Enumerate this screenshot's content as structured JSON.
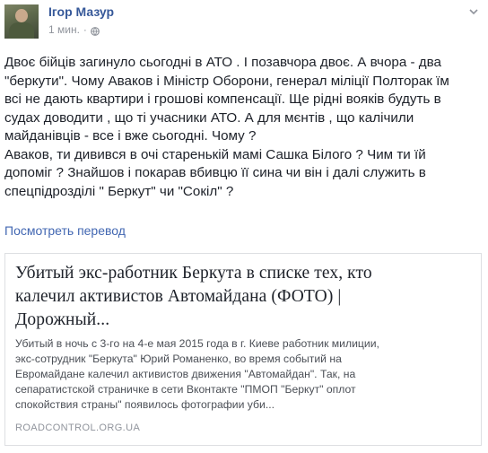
{
  "header": {
    "author_name": "Ігор Мазур",
    "timestamp": "1 мин.",
    "separator": "·",
    "privacy_icon": "globe-icon",
    "menu_icon": "chevron-down-icon"
  },
  "post": {
    "lines": [
      "Двоє бійців загинуло сьогодні в АТО . І позавчора двоє. А вчора - два",
      "\"беркути\". Чому Аваков і Міністр Оборони, генерал міліції Полторак їм",
      "всі не дають квартири і грошові компенсації. Ще рідні вояків будуть в",
      "судах доводити , що ті учасники АТО. А для мєнтів , що калічили",
      "майданівців - все і вже сьогодні. Чому ?",
      "Аваков, ти дивився в очі старенькій мамі Сашка Білого ? Чим ти їй",
      "допоміг ? Знайшов і покарав вбивцю її сина чи він і далі служить в",
      "спецпідрозділі \" Беркут\" чи \"Сокіл\" ?"
    ],
    "see_translation": "Посмотреть перевод"
  },
  "link_card": {
    "title_lines": [
      "Убитый экс-работник Беркута в списке тех, кто",
      "калечил активистов Автомайдана (ФОТО) |",
      "Дорожный..."
    ],
    "description_lines": [
      "Убитый в ночь с 3-го на 4-е мая 2015 года в г. Киеве работник милиции,",
      "экс-сотрудник \"Беркута\" Юрий Романенко, во время событий на",
      "Евромайдане калечил активистов движения \"Автомайдан\". Так, на",
      "сепаратистской страничке в сети Вконтакте \"ПМОП \"Беркут\" оплот",
      "спокойствия страны\" появилось фотографии уби..."
    ],
    "domain": "ROADCONTROL.ORG.UA"
  },
  "colors": {
    "author_link": "#365899",
    "translation_link": "#4267b2",
    "text": "#1d2129",
    "meta_gray": "#90949c",
    "card_border": "#dddfe2"
  }
}
